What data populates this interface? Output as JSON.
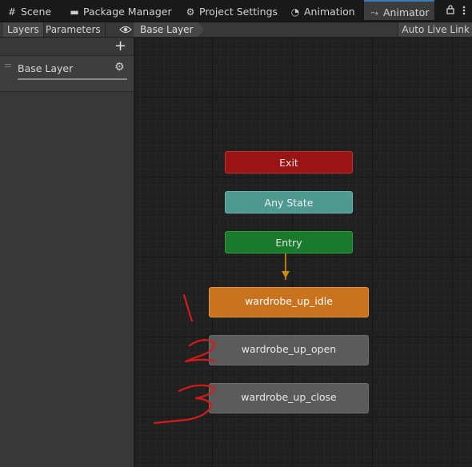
{
  "tabs": [
    {
      "label": "Scene",
      "icon": "scene-icon",
      "glyph": "#"
    },
    {
      "label": "Package Manager",
      "icon": "package-icon",
      "glyph": "▬"
    },
    {
      "label": "Project Settings",
      "icon": "gear-icon",
      "glyph": "⚙"
    },
    {
      "label": "Animation",
      "icon": "clock-icon",
      "glyph": "◔"
    },
    {
      "label": "Animator",
      "icon": "animator-icon",
      "glyph": "⤳",
      "active": true
    }
  ],
  "subbar": {
    "layers_label": "Layers",
    "parameters_label": "Parameters",
    "breadcrumb": "Base Layer",
    "live_link": "Auto Live Link"
  },
  "left_panel": {
    "add_glyph": "+",
    "layer_name": "Base Layer"
  },
  "graph": {
    "nodes": {
      "exit": "Exit",
      "any_state": "Any State",
      "entry": "Entry",
      "idle": "wardrobe_up_idle",
      "open": "wardrobe_up_open",
      "close": "wardrobe_up_close"
    },
    "annotations": [
      "1",
      "2",
      "3"
    ]
  },
  "colors": {
    "exit": "#9b1414",
    "any_state": "#4e9a91",
    "entry": "#1a7a2c",
    "default_state": "#c9731f",
    "state": "#5b5b5b",
    "annotation": "#d61a1a",
    "accent": "#3a79bb"
  }
}
